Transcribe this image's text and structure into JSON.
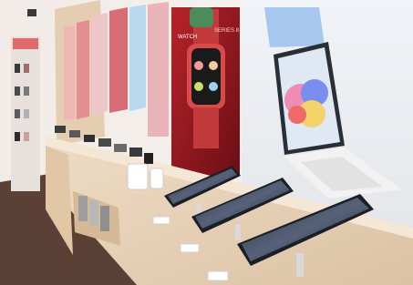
{
  "photo": {
    "subject": "retail-store-tablet-display",
    "poster_watch_brand": "WATCH",
    "poster_watch_series": "SERIES 8"
  },
  "colors": {
    "wall": "#efe8e4",
    "floor": "#5b4035",
    "counter": "#e9d6bf",
    "accent_red": "#d94a4a",
    "ipad_blue": "#a7c7ef",
    "keyboard": "#f2f2f2"
  }
}
